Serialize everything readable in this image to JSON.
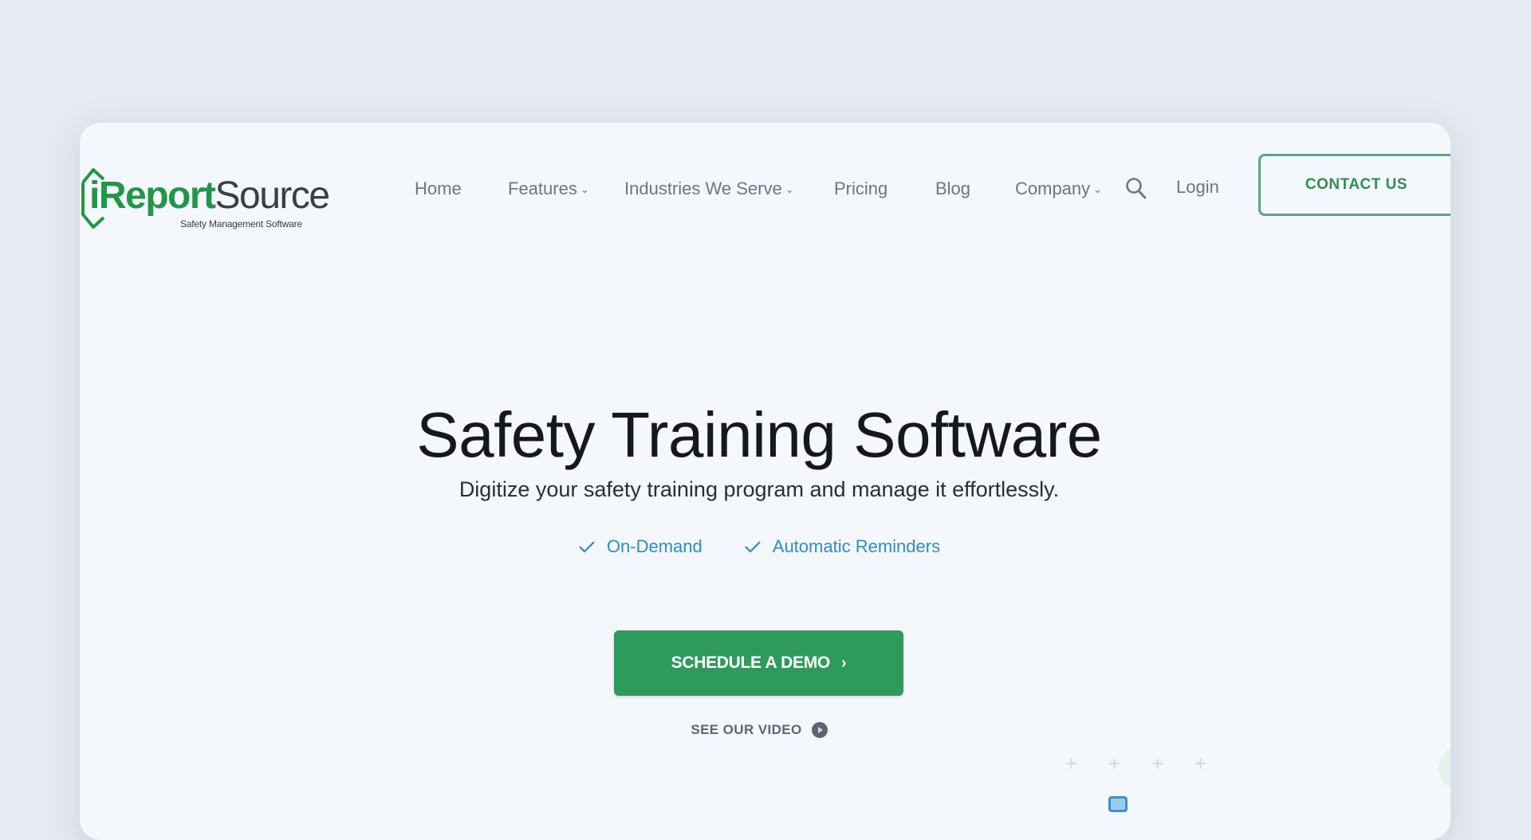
{
  "brand": {
    "name_part1": "iReport",
    "name_part2": "Source",
    "tagline": "Safety Management Software",
    "primary_color": "#23954b"
  },
  "nav": {
    "items": [
      {
        "label": "Home",
        "has_dropdown": false
      },
      {
        "label": "Features",
        "has_dropdown": true
      },
      {
        "label": "Industries We Serve",
        "has_dropdown": true
      },
      {
        "label": "Pricing",
        "has_dropdown": false
      },
      {
        "label": "Blog",
        "has_dropdown": false
      },
      {
        "label": "Company",
        "has_dropdown": true
      }
    ],
    "search_icon": "search-icon",
    "login_label": "Login",
    "contact_label": "CONTACT US",
    "chevron": "⌄"
  },
  "hero": {
    "title": "Safety Training Software",
    "subtitle": "Digitize your safety training program and manage it effortlessly.",
    "features": [
      "On-Demand",
      "Automatic Reminders"
    ],
    "feature_color": "#2a8ec3",
    "cta_label": "SCHEDULE A DEMO",
    "cta_arrow": "›",
    "cta_color": "#2e9a5c",
    "video_label": "SEE OUR VIDEO"
  },
  "decorations": {
    "plus_symbol": "+"
  }
}
